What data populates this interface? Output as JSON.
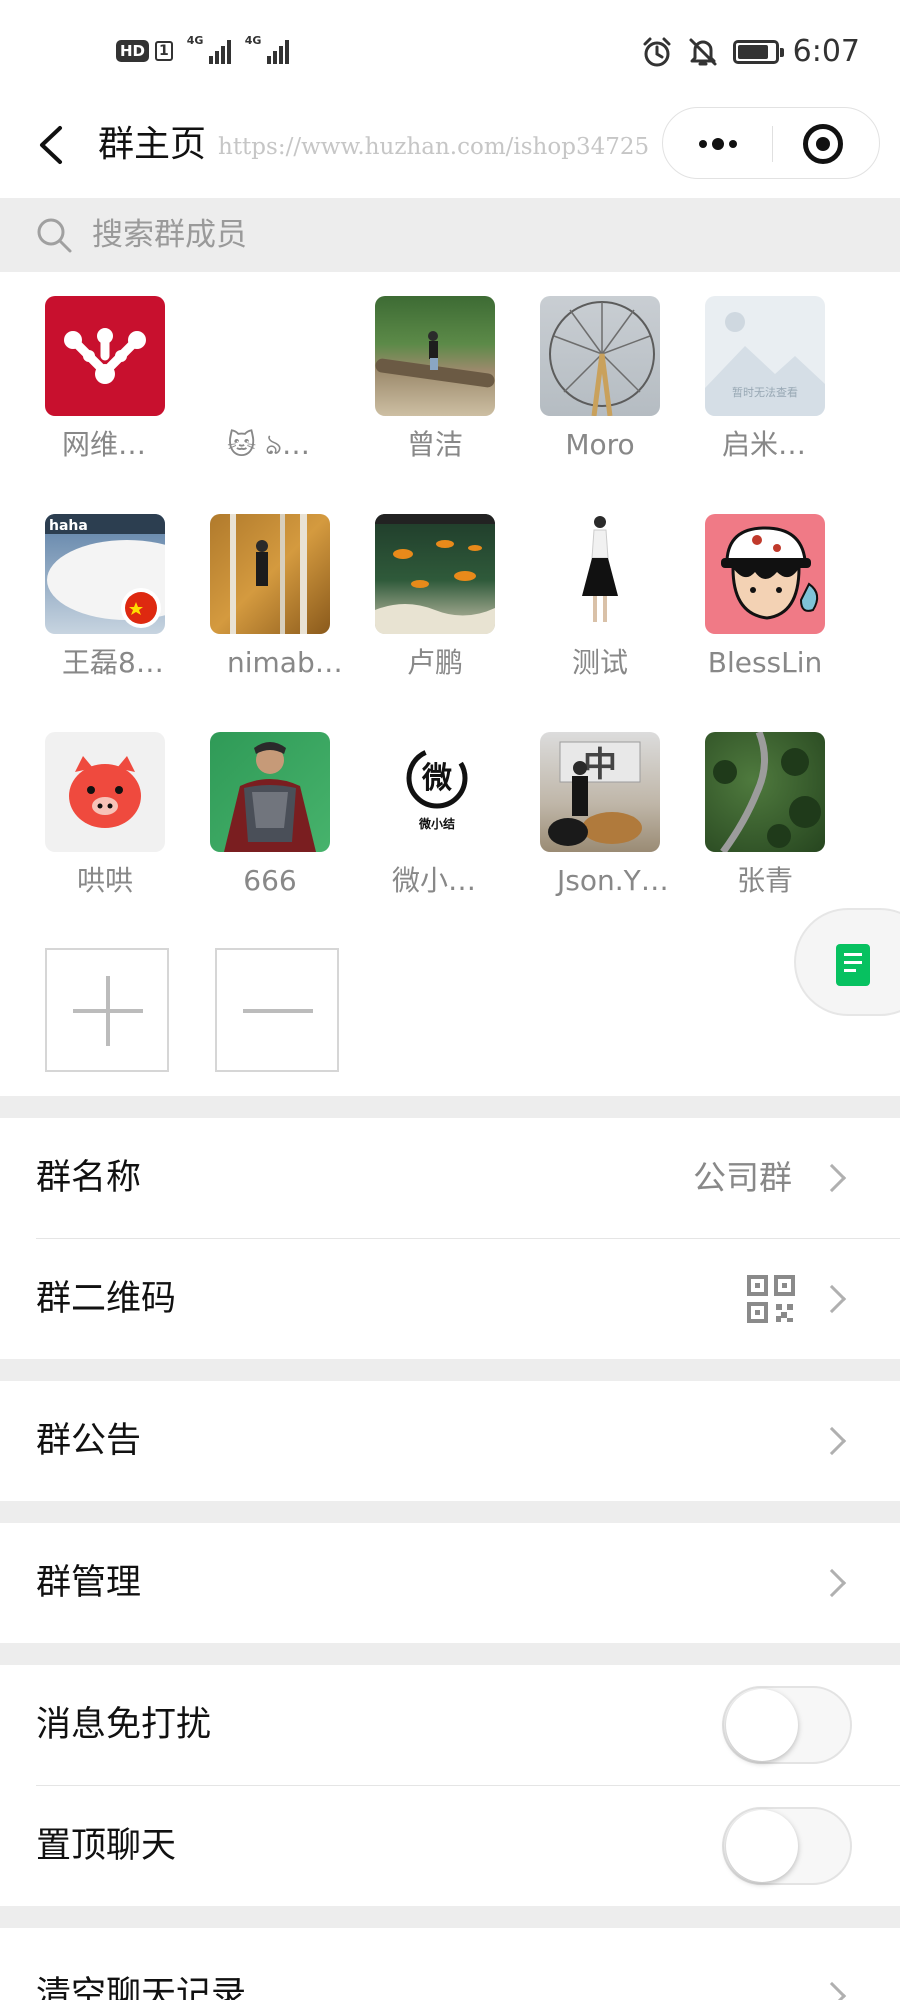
{
  "status_bar": {
    "hd_badge": "HD",
    "sim_number": "1",
    "network_1": "4G",
    "network_2": "4G",
    "time": "6:07",
    "icons": [
      "alarm-icon",
      "mute-bell-icon",
      "battery-icon"
    ],
    "battery_level": 0.85
  },
  "nav": {
    "title": "群主页",
    "watermark": "https://www.huzhan.com/ishop34725",
    "back_icon": "chevron-left-icon",
    "capsule_icons": [
      "more-dots-icon",
      "mini-close-icon"
    ]
  },
  "search": {
    "placeholder": "搜索群成员",
    "icon": "search-icon"
  },
  "members": [
    {
      "name": "网维…",
      "avatar": "red-logo"
    },
    {
      "name": "🐱 ঌ…",
      "avatar": "blank"
    },
    {
      "name": "曾洁",
      "avatar": "photo-person-log"
    },
    {
      "name": "Moro",
      "avatar": "photo-ferris-wheel"
    },
    {
      "name": "启米…",
      "avatar": "placeholder-unavailable",
      "avatar_text": "暂时无法查看"
    },
    {
      "name": "王磊8…",
      "avatar": "photo-airplane",
      "avatar_text": "haha"
    },
    {
      "name": "nimab…",
      "avatar": "photo-forest-person"
    },
    {
      "name": "卢鹏",
      "avatar": "photo-aquarium"
    },
    {
      "name": "测试",
      "avatar": "photo-fashion-figure"
    },
    {
      "name": "BlessLin",
      "avatar": "cartoon-boy-cap"
    },
    {
      "name": "哄哄",
      "avatar": "cartoon-pig"
    },
    {
      "name": "666",
      "avatar": "photo-costume-man"
    },
    {
      "name": "微小…",
      "avatar": "logo-wei",
      "avatar_text": "微",
      "avatar_subtext": "微小结"
    },
    {
      "name": "Json.Y…",
      "avatar": "photo-dog-owner",
      "avatar_text": "中"
    },
    {
      "name": "张青",
      "avatar": "photo-aerial-road"
    }
  ],
  "member_ops": {
    "add_icon": "plus-icon",
    "remove_icon": "minus-icon"
  },
  "float_button": {
    "icon": "document-icon",
    "accent": "#07c160"
  },
  "settings": {
    "group_name": {
      "label": "群名称",
      "value": "公司群"
    },
    "group_qr": {
      "label": "群二维码",
      "icon": "qr-code-icon"
    },
    "announcement": {
      "label": "群公告"
    },
    "manage": {
      "label": "群管理"
    },
    "mute": {
      "label": "消息免打扰",
      "on": false
    },
    "pin": {
      "label": "置顶聊天",
      "on": false
    },
    "clear": {
      "label": "清空聊天记录"
    }
  },
  "colors": {
    "background_gray": "#ededed",
    "brand_green": "#07c160",
    "avatar_red": "#c8102e"
  }
}
